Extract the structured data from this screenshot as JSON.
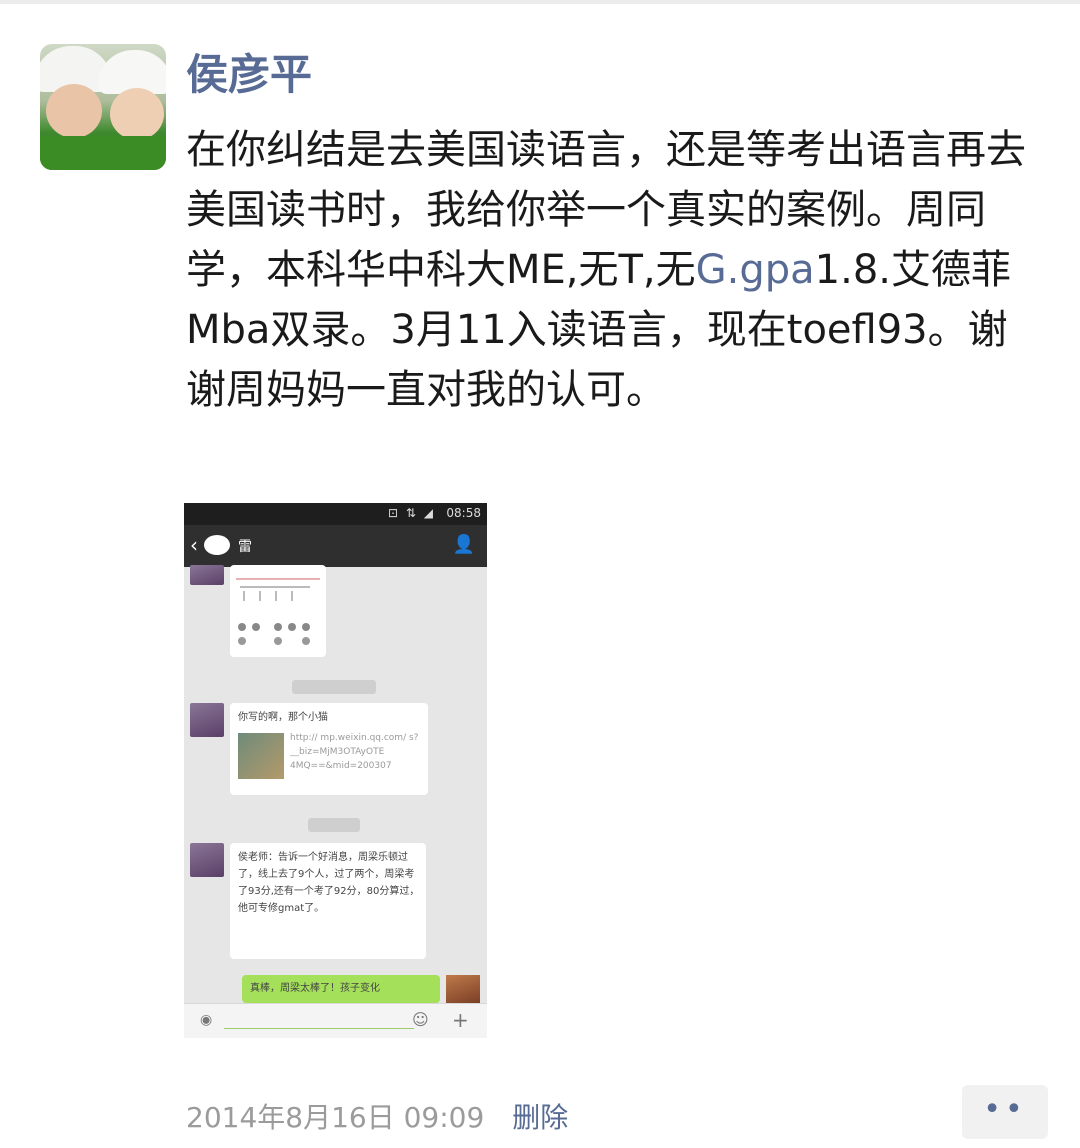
{
  "post": {
    "author": "侯彦平",
    "text_parts": [
      "在你纠结是去美国读语言，还是等考出语言再去美国读书时，我给你举一个真实的案例。周同学，本科华中科大ME,无T,无",
      "G.gpa",
      "1.8.艾德菲Mba双录。3月11入读语言，现在toefl93。谢谢周妈妈一直对我的认可。"
    ],
    "timestamp": "2014年8月16日 09:09",
    "delete_label": "删除",
    "more_label": "••"
  },
  "screenshot": {
    "status_time": "08:58",
    "status_icons": "⊡ ⇅ ◢",
    "chat_title": "雷",
    "msg1_text": "你写的啊，那个小猫",
    "msg1_link": "http:// mp.weixin.qq.com/ s?__biz=MjM3OTAyOTE 4MQ==&mid=200307",
    "msg2_text": "侯老师：告诉一个好消息，周梁乐顿过了，线上去了9个人，过了两个，周梁考了93分,还有一个考了92分，80分算过，他可专修gmat了。",
    "msg3_text": "真棒，周梁太棒了！孩子变化",
    "voice_icon": "◉",
    "emoji_icon": "☺",
    "plus_icon": "+",
    "back_icon": "‹",
    "person_icon": "👤"
  }
}
